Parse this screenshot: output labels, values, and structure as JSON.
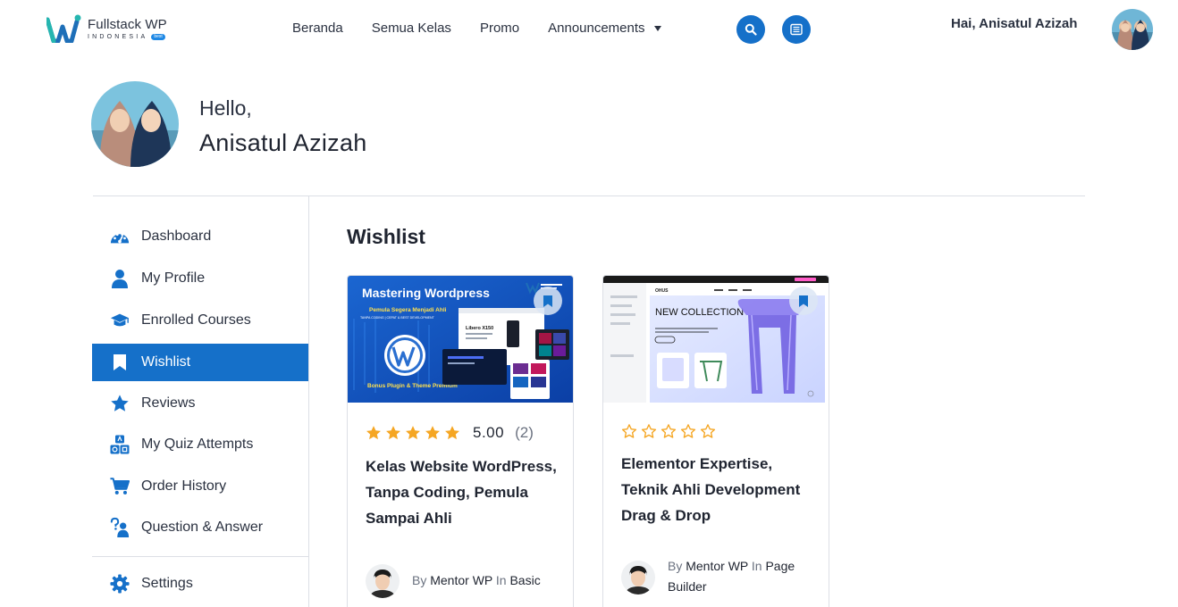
{
  "header": {
    "logo": {
      "name": "Fullstack WP",
      "country": "INDONESIA",
      "badge": "best"
    },
    "nav": [
      {
        "label": "Beranda"
      },
      {
        "label": "Semua Kelas"
      },
      {
        "label": "Promo"
      },
      {
        "label": "Announcements",
        "has_dropdown": true
      }
    ],
    "buttons": {
      "search_icon": "search-icon",
      "list_icon": "list-icon"
    },
    "greeting": "Hai, Anisatul Azizah"
  },
  "profile": {
    "hello": "Hello,",
    "name": "Anisatul Azizah"
  },
  "sidebar": {
    "items": [
      {
        "label": "Dashboard",
        "icon": "dashboard-icon"
      },
      {
        "label": "My Profile",
        "icon": "user-icon"
      },
      {
        "label": "Enrolled Courses",
        "icon": "graduation-cap-icon"
      },
      {
        "label": "Wishlist",
        "icon": "bookmark-icon",
        "active": true
      },
      {
        "label": "Reviews",
        "icon": "star-icon"
      },
      {
        "label": "My Quiz Attempts",
        "icon": "shapes-icon"
      },
      {
        "label": "Order History",
        "icon": "cart-icon"
      },
      {
        "label": "Question & Answer",
        "icon": "question-icon"
      }
    ],
    "settings": {
      "label": "Settings",
      "icon": "gear-icon"
    }
  },
  "main": {
    "title": "Wishlist",
    "courses": [
      {
        "thumb": {
          "headline": "Mastering Wordpress",
          "tagline": "Pemula Segera Menjadi Ahli",
          "subline": "TANPA CODING | CEPAT & BEST DEVELOPMENT",
          "bonus": "Bonus Plugin & Theme Premium",
          "mock_brand": "Libero X150"
        },
        "rating": {
          "stars": 5,
          "value": "5.00",
          "count": "(2)"
        },
        "title": "Kelas Website WordPress, Tanpa Coding, Pemula Sampai Ahli",
        "meta": {
          "by": "By",
          "author": "Mentor WP",
          "in": "In",
          "category": "Basic"
        }
      },
      {
        "thumb": {
          "headline": "NEW COLLECTION",
          "brand": "OHUS"
        },
        "rating": {
          "stars": 0,
          "value": "",
          "count": ""
        },
        "title": "Elementor Expertise, Teknik Ahli Development Drag & Drop",
        "meta": {
          "by": "By",
          "author": "Mentor WP",
          "in": "In",
          "category": "Page Builder"
        }
      }
    ]
  },
  "colors": {
    "accent": "#1570c9",
    "star": "#f5a623",
    "text": "#1f2430",
    "muted": "#6b7280",
    "border": "#dcdfe5"
  }
}
